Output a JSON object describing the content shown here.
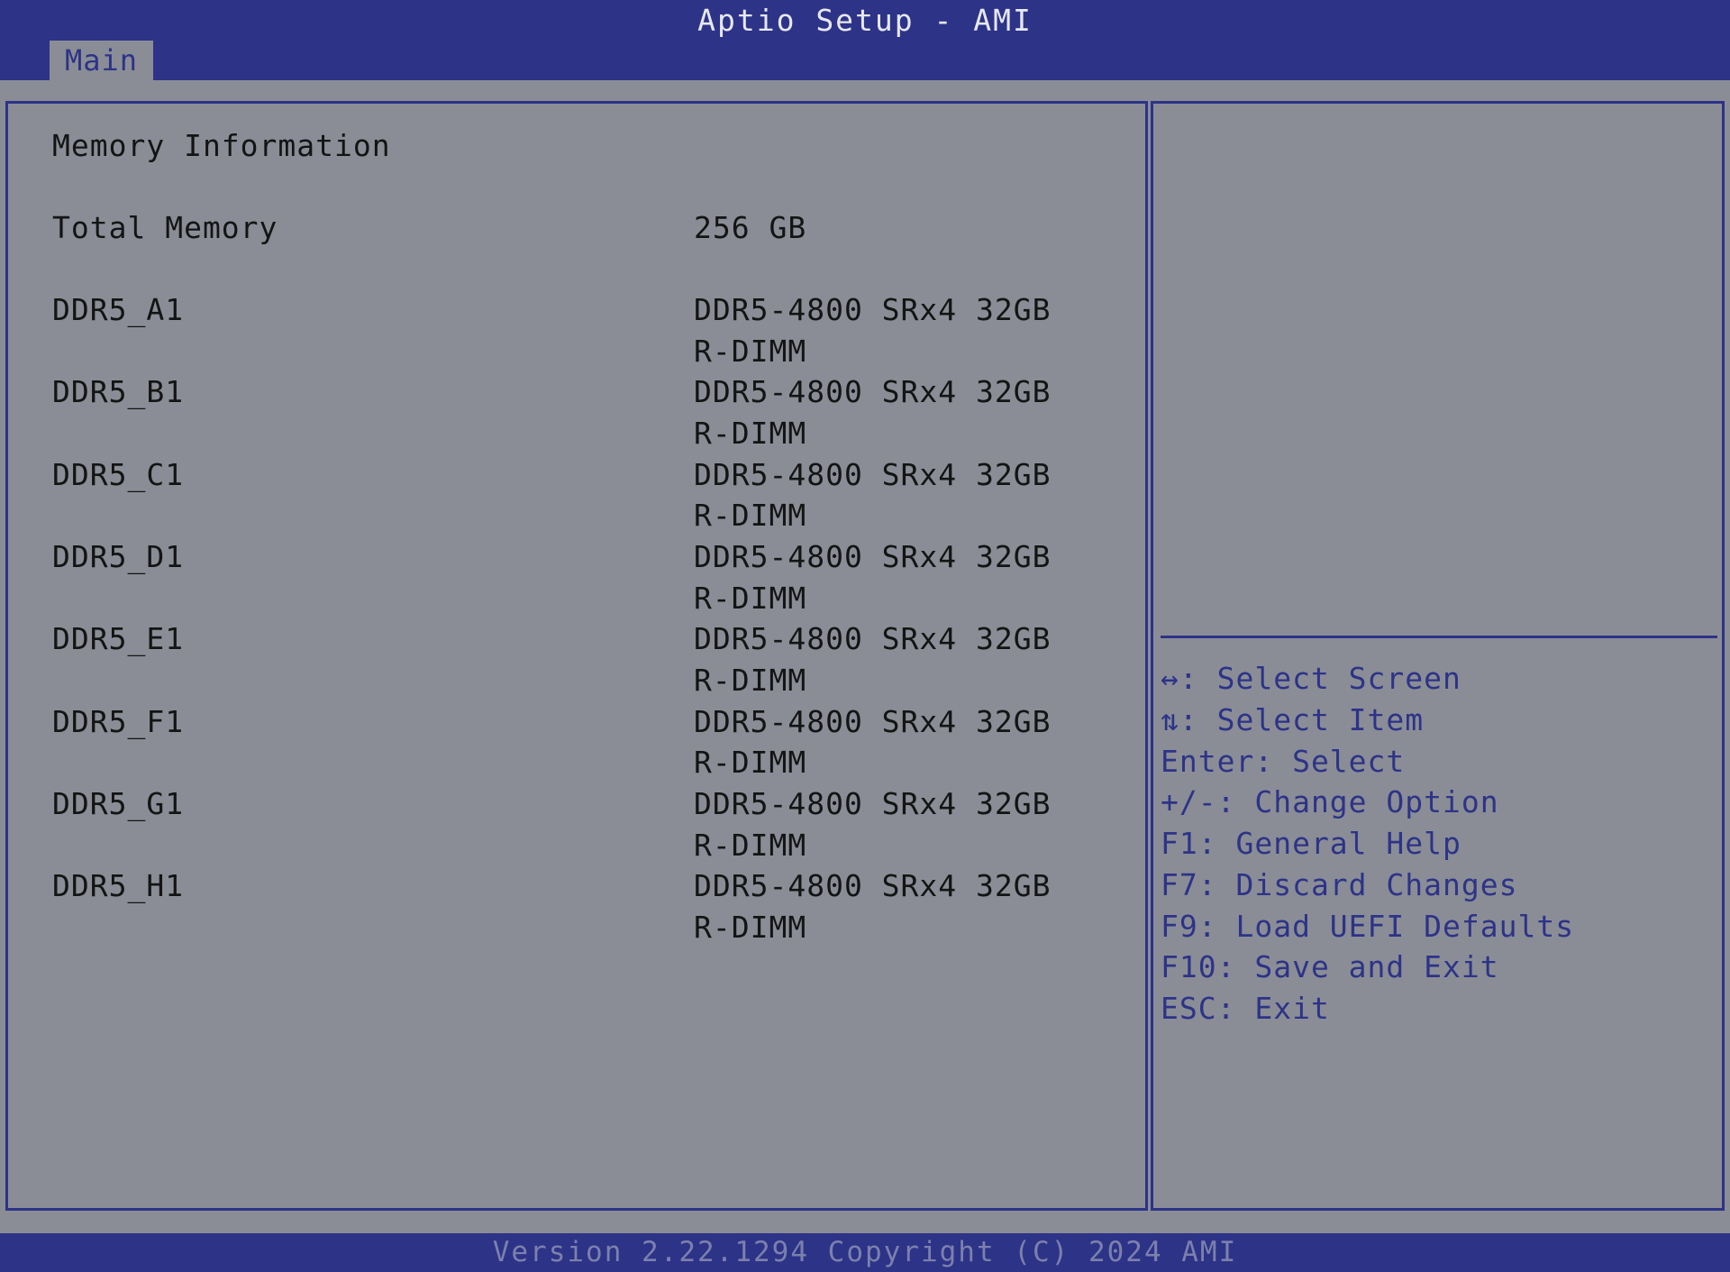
{
  "header": {
    "title": "Aptio Setup - AMI",
    "tabs": [
      {
        "label": "Main"
      }
    ]
  },
  "main": {
    "section_title": "Memory Information",
    "total_memory": {
      "label": "Total Memory",
      "value": "256 GB"
    },
    "dimms": [
      {
        "label": "DDR5_A1",
        "value_line1": "DDR5-4800 SRx4 32GB",
        "value_line2": "R-DIMM"
      },
      {
        "label": "DDR5_B1",
        "value_line1": "DDR5-4800 SRx4 32GB",
        "value_line2": "R-DIMM"
      },
      {
        "label": "DDR5_C1",
        "value_line1": "DDR5-4800 SRx4 32GB",
        "value_line2": "R-DIMM"
      },
      {
        "label": "DDR5_D1",
        "value_line1": "DDR5-4800 SRx4 32GB",
        "value_line2": "R-DIMM"
      },
      {
        "label": "DDR5_E1",
        "value_line1": "DDR5-4800 SRx4 32GB",
        "value_line2": "R-DIMM"
      },
      {
        "label": "DDR5_F1",
        "value_line1": "DDR5-4800 SRx4 32GB",
        "value_line2": "R-DIMM"
      },
      {
        "label": "DDR5_G1",
        "value_line1": "DDR5-4800 SRx4 32GB",
        "value_line2": "R-DIMM"
      },
      {
        "label": "DDR5_H1",
        "value_line1": "DDR5-4800 SRx4 32GB",
        "value_line2": "R-DIMM"
      }
    ]
  },
  "help": {
    "items": [
      "↔: Select Screen",
      "⇅: Select Item",
      "Enter: Select",
      "+/-: Change Option",
      "F1: General Help",
      "F7: Discard Changes",
      "F9: Load UEFI Defaults",
      "F10: Save and Exit",
      "ESC: Exit"
    ]
  },
  "footer": {
    "text": "Version 2.22.1294 Copyright (C) 2024 AMI"
  },
  "colors": {
    "background": "#8a8d96",
    "accent": "#2d3387",
    "text": "#141414"
  }
}
